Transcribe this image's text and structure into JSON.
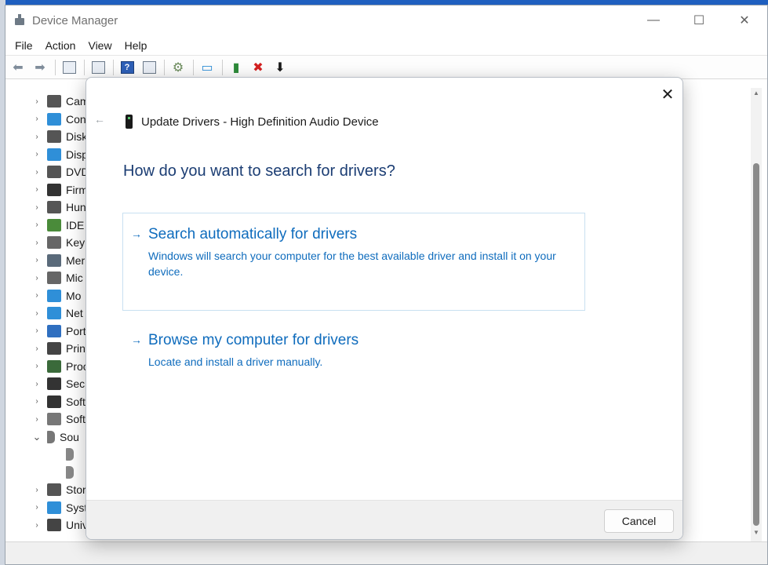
{
  "window": {
    "title": "Device Manager",
    "controls": {
      "minimize": "—",
      "maximize": "☐",
      "close": "✕"
    }
  },
  "menu": [
    "File",
    "Action",
    "View",
    "Help"
  ],
  "tree": {
    "items": [
      {
        "label": "Cam",
        "icon": "camera-icon",
        "color": "#555555",
        "expanded": false
      },
      {
        "label": "Con",
        "icon": "monitor-icon",
        "color": "#2f8fd8",
        "expanded": false
      },
      {
        "label": "Disk",
        "icon": "disk-drive-icon",
        "color": "#555555",
        "expanded": false
      },
      {
        "label": "Disp",
        "icon": "display-adapter-icon",
        "color": "#2f8fd8",
        "expanded": false
      },
      {
        "label": "DVD",
        "icon": "dvd-drive-icon",
        "color": "#555555",
        "expanded": false
      },
      {
        "label": "Firm",
        "icon": "firmware-icon",
        "color": "#333333",
        "expanded": false
      },
      {
        "label": "Hun",
        "icon": "hid-icon",
        "color": "#555555",
        "expanded": false
      },
      {
        "label": "IDE",
        "icon": "ide-controller-icon",
        "color": "#4a8b3a",
        "expanded": false
      },
      {
        "label": "Key",
        "icon": "keyboard-icon",
        "color": "#666666",
        "expanded": false
      },
      {
        "label": "Mer",
        "icon": "memory-icon",
        "color": "#5a6a7a",
        "expanded": false
      },
      {
        "label": "Mic",
        "icon": "mouse-icon",
        "color": "#666666",
        "expanded": false
      },
      {
        "label": "Mo",
        "icon": "monitor-icon",
        "color": "#2f8fd8",
        "expanded": false
      },
      {
        "label": "Net",
        "icon": "network-icon",
        "color": "#2f8fd8",
        "expanded": false
      },
      {
        "label": "Port",
        "icon": "port-icon",
        "color": "#2f6fc0",
        "expanded": false
      },
      {
        "label": "Prin",
        "icon": "printer-icon",
        "color": "#444444",
        "expanded": false
      },
      {
        "label": "Proc",
        "icon": "processor-icon",
        "color": "#3a6a3a",
        "expanded": false
      },
      {
        "label": "Secu",
        "icon": "security-key-icon",
        "color": "#333333",
        "expanded": false
      },
      {
        "label": "Soft",
        "icon": "software-component-icon",
        "color": "#333333",
        "expanded": false
      },
      {
        "label": "Soft",
        "icon": "software-device-icon",
        "color": "#777777",
        "expanded": false
      },
      {
        "label": "Sou",
        "icon": "speaker-icon",
        "color": "#777777",
        "expanded": true
      },
      {
        "label": "",
        "icon": "speaker-icon",
        "color": "#888888",
        "child": true
      },
      {
        "label": "",
        "icon": "speaker-icon",
        "color": "#888888",
        "child": true
      },
      {
        "label": "Stor",
        "icon": "storage-icon",
        "color": "#555555",
        "expanded": false
      },
      {
        "label": "Syst",
        "icon": "system-icon",
        "color": "#2f8fd8",
        "expanded": false
      },
      {
        "label": "Univ",
        "icon": "usb-icon",
        "color": "#444444",
        "expanded": false
      }
    ]
  },
  "dialog": {
    "title": "Update Drivers - High Definition Audio Device",
    "heading": "How do you want to search for drivers?",
    "options": [
      {
        "title": "Search automatically for drivers",
        "description": "Windows will search your computer for the best available driver and install it on your device."
      },
      {
        "title": "Browse my computer for drivers",
        "description": "Locate and install a driver manually."
      }
    ],
    "cancel_label": "Cancel",
    "close_glyph": "✕",
    "back_glyph": "←",
    "arrow_glyph": "→"
  },
  "colors": {
    "link_blue": "#0f6cbd",
    "heading_blue": "#1b3d73",
    "selected_border": "#c9e0f1"
  }
}
